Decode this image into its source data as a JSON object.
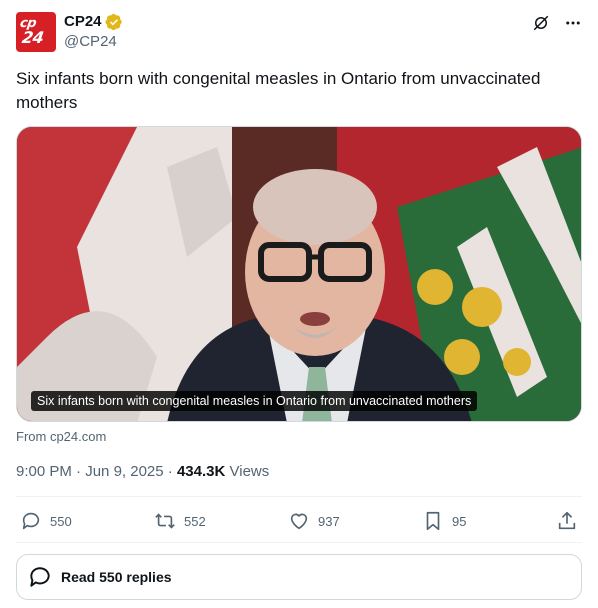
{
  "account": {
    "display_name": "CP24",
    "handle": "@CP24",
    "avatar_text_line1": "cp",
    "avatar_text_line2": "24",
    "brand_color": "#d71f26",
    "verified_color": "#e2b719"
  },
  "tweet": {
    "text": "Six infants born with congenital measles in Ontario from unvaccinated mothers",
    "media_caption": "Six infants born with congenital measles in Ontario from unvaccinated mothers",
    "source": "From cp24.com",
    "time": "9:00 PM",
    "separator": "·",
    "date": "Jun 9, 2025",
    "views_count": "434.3K",
    "views_label": "Views"
  },
  "actions": {
    "replies": "550",
    "reposts": "552",
    "likes": "937",
    "bookmarks": "95"
  },
  "read_replies_label": "Read 550 replies",
  "icons": [
    "verified-badge-icon",
    "grok-icon",
    "more-icon",
    "reply-icon",
    "repost-icon",
    "like-icon",
    "bookmark-icon",
    "share-icon",
    "replies-bubble-icon"
  ]
}
